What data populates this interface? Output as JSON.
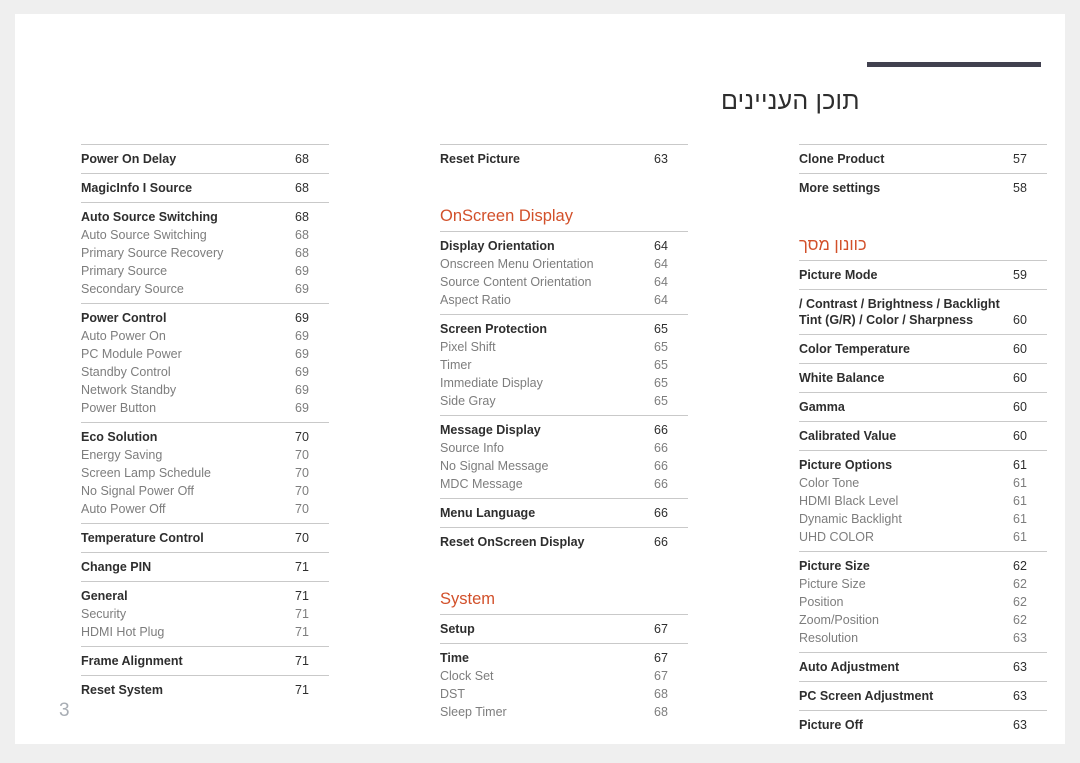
{
  "header": {
    "title": "תוכן העניינים",
    "rule_color": "#41414f"
  },
  "accent_color": "#d2502a",
  "page_number": "3",
  "columns": [
    {
      "name": "column-left",
      "blocks": [
        {
          "type": "group",
          "rule": true,
          "rows": [
            {
              "page": "68",
              "label": "Power On Delay",
              "level": 1
            }
          ]
        },
        {
          "type": "group",
          "rule": true,
          "rows": [
            {
              "page": "68",
              "label": "MagicInfo I Source",
              "level": 1
            }
          ]
        },
        {
          "type": "group",
          "rule": true,
          "rows": [
            {
              "page": "68",
              "label": "Auto Source Switching",
              "level": 1
            },
            {
              "page": "68",
              "label": "Auto Source Switching",
              "level": 2
            },
            {
              "page": "68",
              "label": "Primary Source Recovery",
              "level": 2
            },
            {
              "page": "69",
              "label": "Primary Source",
              "level": 2
            },
            {
              "page": "69",
              "label": "Secondary Source",
              "level": 2
            }
          ]
        },
        {
          "type": "group",
          "rule": true,
          "rows": [
            {
              "page": "69",
              "label": "Power Control",
              "level": 1
            },
            {
              "page": "69",
              "label": "Auto Power On",
              "level": 2
            },
            {
              "page": "69",
              "label": "PC Module Power",
              "level": 2
            },
            {
              "page": "69",
              "label": "Standby Control",
              "level": 2
            },
            {
              "page": "69",
              "label": "Network Standby",
              "level": 2
            },
            {
              "page": "69",
              "label": "Power Button",
              "level": 2
            }
          ]
        },
        {
          "type": "group",
          "rule": true,
          "rows": [
            {
              "page": "70",
              "label": "Eco Solution",
              "level": 1
            },
            {
              "page": "70",
              "label": "Energy Saving",
              "level": 2
            },
            {
              "page": "70",
              "label": "Screen Lamp Schedule",
              "level": 2
            },
            {
              "page": "70",
              "label": "No Signal Power Off",
              "level": 2
            },
            {
              "page": "70",
              "label": "Auto Power Off",
              "level": 2
            }
          ]
        },
        {
          "type": "group",
          "rule": true,
          "rows": [
            {
              "page": "70",
              "label": "Temperature Control",
              "level": 1
            }
          ]
        },
        {
          "type": "group",
          "rule": true,
          "rows": [
            {
              "page": "71",
              "label": "Change PIN",
              "level": 1
            }
          ]
        },
        {
          "type": "group",
          "rule": true,
          "rows": [
            {
              "page": "71",
              "label": "General",
              "level": 1
            },
            {
              "page": "71",
              "label": "Security",
              "level": 2
            },
            {
              "page": "71",
              "label": "HDMI Hot Plug",
              "level": 2
            }
          ]
        },
        {
          "type": "group",
          "rule": true,
          "rows": [
            {
              "page": "71",
              "label": "Frame Alignment",
              "level": 1
            }
          ]
        },
        {
          "type": "group",
          "rule": true,
          "rows": [
            {
              "page": "71",
              "label": "Reset System",
              "level": 1
            }
          ]
        }
      ]
    },
    {
      "name": "column-middle",
      "blocks": [
        {
          "type": "group",
          "rule": true,
          "rows": [
            {
              "page": "63",
              "label": "Reset Picture",
              "level": 1
            }
          ]
        },
        {
          "type": "spacer"
        },
        {
          "type": "heading",
          "label": "OnScreen Display"
        },
        {
          "type": "group",
          "rule": true,
          "rows": [
            {
              "page": "64",
              "label": "Display Orientation",
              "level": 1
            },
            {
              "page": "64",
              "label": "Onscreen Menu Orientation",
              "level": 2
            },
            {
              "page": "64",
              "label": "Source Content Orientation",
              "level": 2
            },
            {
              "page": "64",
              "label": "Aspect Ratio",
              "level": 2
            }
          ]
        },
        {
          "type": "group",
          "rule": true,
          "rows": [
            {
              "page": "65",
              "label": "Screen Protection",
              "level": 1
            },
            {
              "page": "65",
              "label": "Pixel Shift",
              "level": 2
            },
            {
              "page": "65",
              "label": "Timer",
              "level": 2
            },
            {
              "page": "65",
              "label": "Immediate Display",
              "level": 2
            },
            {
              "page": "65",
              "label": "Side Gray",
              "level": 2
            }
          ]
        },
        {
          "type": "group",
          "rule": true,
          "rows": [
            {
              "page": "66",
              "label": "Message Display",
              "level": 1
            },
            {
              "page": "66",
              "label": "Source Info",
              "level": 2
            },
            {
              "page": "66",
              "label": "No Signal Message",
              "level": 2
            },
            {
              "page": "66",
              "label": "MDC Message",
              "level": 2
            }
          ]
        },
        {
          "type": "group",
          "rule": true,
          "rows": [
            {
              "page": "66",
              "label": "Menu Language",
              "level": 1
            }
          ]
        },
        {
          "type": "group",
          "rule": true,
          "rows": [
            {
              "page": "66",
              "label": "Reset OnScreen Display",
              "level": 1
            }
          ]
        },
        {
          "type": "spacer"
        },
        {
          "type": "heading",
          "label": "System"
        },
        {
          "type": "group",
          "rule": true,
          "rows": [
            {
              "page": "67",
              "label": "Setup",
              "level": 1
            }
          ]
        },
        {
          "type": "group",
          "rule": true,
          "rows": [
            {
              "page": "67",
              "label": "Time",
              "level": 1
            },
            {
              "page": "67",
              "label": "Clock Set",
              "level": 2
            },
            {
              "page": "68",
              "label": "DST",
              "level": 2
            },
            {
              "page": "68",
              "label": "Sleep Timer",
              "level": 2
            }
          ]
        }
      ]
    },
    {
      "name": "column-right",
      "blocks": [
        {
          "type": "group",
          "rule": true,
          "rows": [
            {
              "page": "57",
              "label": "Clone Product",
              "level": 1
            }
          ]
        },
        {
          "type": "group",
          "rule": true,
          "rows": [
            {
              "page": "58",
              "label": "More settings",
              "level": 1
            }
          ]
        },
        {
          "type": "spacer"
        },
        {
          "type": "heading",
          "label": "כוונון מסך"
        },
        {
          "type": "group",
          "rule": true,
          "rows": [
            {
              "page": "59",
              "label": "Picture Mode",
              "level": 1
            }
          ]
        },
        {
          "type": "group",
          "rule": true,
          "rows": [
            {
              "page": "60",
              "label": "/ Contrast / Brightness / Backlight\nTint (G/R) / Color / Sharpness",
              "level": 1,
              "multiline": true
            }
          ]
        },
        {
          "type": "group",
          "rule": true,
          "rows": [
            {
              "page": "60",
              "label": "Color Temperature",
              "level": 1
            }
          ]
        },
        {
          "type": "group",
          "rule": true,
          "rows": [
            {
              "page": "60",
              "label": "White Balance",
              "level": 1
            }
          ]
        },
        {
          "type": "group",
          "rule": true,
          "rows": [
            {
              "page": "60",
              "label": "Gamma",
              "level": 1
            }
          ]
        },
        {
          "type": "group",
          "rule": true,
          "rows": [
            {
              "page": "60",
              "label": "Calibrated Value",
              "level": 1
            }
          ]
        },
        {
          "type": "group",
          "rule": true,
          "rows": [
            {
              "page": "61",
              "label": "Picture Options",
              "level": 1
            },
            {
              "page": "61",
              "label": "Color Tone",
              "level": 2
            },
            {
              "page": "61",
              "label": "HDMI Black Level",
              "level": 2
            },
            {
              "page": "61",
              "label": "Dynamic Backlight",
              "level": 2
            },
            {
              "page": "61",
              "label": "UHD COLOR",
              "level": 2
            }
          ]
        },
        {
          "type": "group",
          "rule": true,
          "rows": [
            {
              "page": "62",
              "label": "Picture Size",
              "level": 1
            },
            {
              "page": "62",
              "label": "Picture Size",
              "level": 2
            },
            {
              "page": "62",
              "label": "Position",
              "level": 2
            },
            {
              "page": "62",
              "label": "Zoom/Position",
              "level": 2
            },
            {
              "page": "63",
              "label": "Resolution",
              "level": 2
            }
          ]
        },
        {
          "type": "group",
          "rule": true,
          "rows": [
            {
              "page": "63",
              "label": "Auto Adjustment",
              "level": 1
            }
          ]
        },
        {
          "type": "group",
          "rule": true,
          "rows": [
            {
              "page": "63",
              "label": "PC Screen Adjustment",
              "level": 1
            }
          ]
        },
        {
          "type": "group",
          "rule": true,
          "rows": [
            {
              "page": "63",
              "label": "Picture Off",
              "level": 1
            }
          ]
        }
      ]
    }
  ]
}
